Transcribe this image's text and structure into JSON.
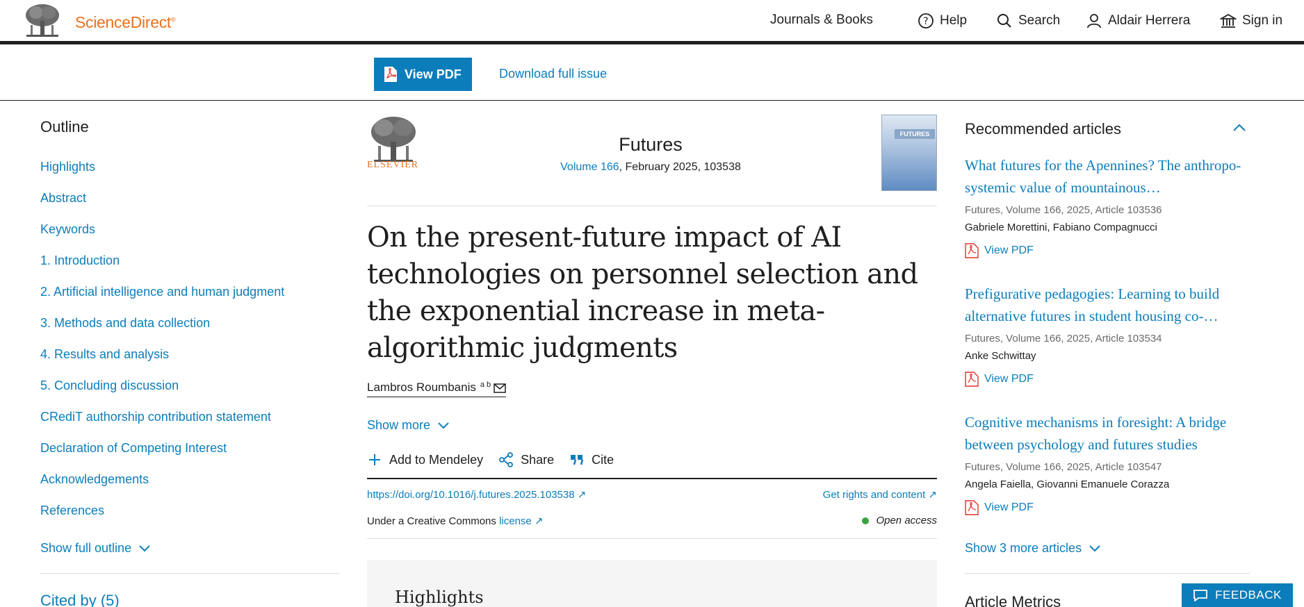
{
  "header": {
    "brand": "ScienceDirect",
    "brand_mark": "®",
    "journals_books": "Journals & Books",
    "help": "Help",
    "search": "Search",
    "user": "Aldair Herrera",
    "sign_in": "Sign in"
  },
  "toolbar": {
    "view_pdf": "View PDF",
    "download_issue": "Download full issue"
  },
  "outline": {
    "title": "Outline",
    "items": [
      "Highlights",
      "Abstract",
      "Keywords",
      "1. Introduction",
      "2. Artificial intelligence and human judgment",
      "3. Methods and data collection",
      "4. Results and analysis",
      "5. Concluding discussion",
      "CRediT authorship contribution statement",
      "Declaration of Competing Interest",
      "Acknowledgements",
      "References"
    ],
    "show_full": "Show full outline",
    "cited_by": "Cited by (5)"
  },
  "article": {
    "publisher": "ELSEVIER",
    "journal": "Futures",
    "volume_link": "Volume 166",
    "issue_meta": ", February 2025, 103538",
    "cover_label": "FUTURES",
    "title": "On the present-future impact of AI technologies on personnel selection and the exponential increase in meta-algorithmic judgments",
    "author": "Lambros Roumbanis",
    "author_sup": "a b",
    "show_more": "Show more",
    "actions": {
      "mendeley": "Add to Mendeley",
      "share": "Share",
      "cite": "Cite"
    },
    "doi": "https://doi.org/10.1016/j.futures.2025.103538",
    "rights": "Get rights and content",
    "cc_prefix": "Under a Creative Commons ",
    "cc_link": "license",
    "open_access": "Open access",
    "highlights": "Highlights"
  },
  "recommended": {
    "title": "Recommended articles",
    "items": [
      {
        "title": "What futures for the Apennines? The anthropo-systemic value of mountainous…",
        "meta": "Futures, Volume 166, 2025, Article 103536",
        "authors": "Gabriele Morettini, Fabiano Compagnucci",
        "pdf": "View PDF"
      },
      {
        "title": "Prefigurative pedagogies: Learning to build alternative futures in student housing co-…",
        "meta": "Futures, Volume 166, 2025, Article 103534",
        "authors": "Anke Schwittay",
        "pdf": "View PDF"
      },
      {
        "title": "Cognitive mechanisms in foresight: A bridge between psychology and futures studies",
        "meta": "Futures, Volume 166, 2025, Article 103547",
        "authors": "Angela Faiella, Giovanni Emanuele Corazza",
        "pdf": "View PDF"
      }
    ],
    "show_more": "Show 3 more articles",
    "metrics": "Article Metrics"
  },
  "feedback": "FEEDBACK",
  "colors": {
    "link": "#0c7dbb",
    "brand": "#e9711c",
    "open_access": "#3aa341"
  }
}
